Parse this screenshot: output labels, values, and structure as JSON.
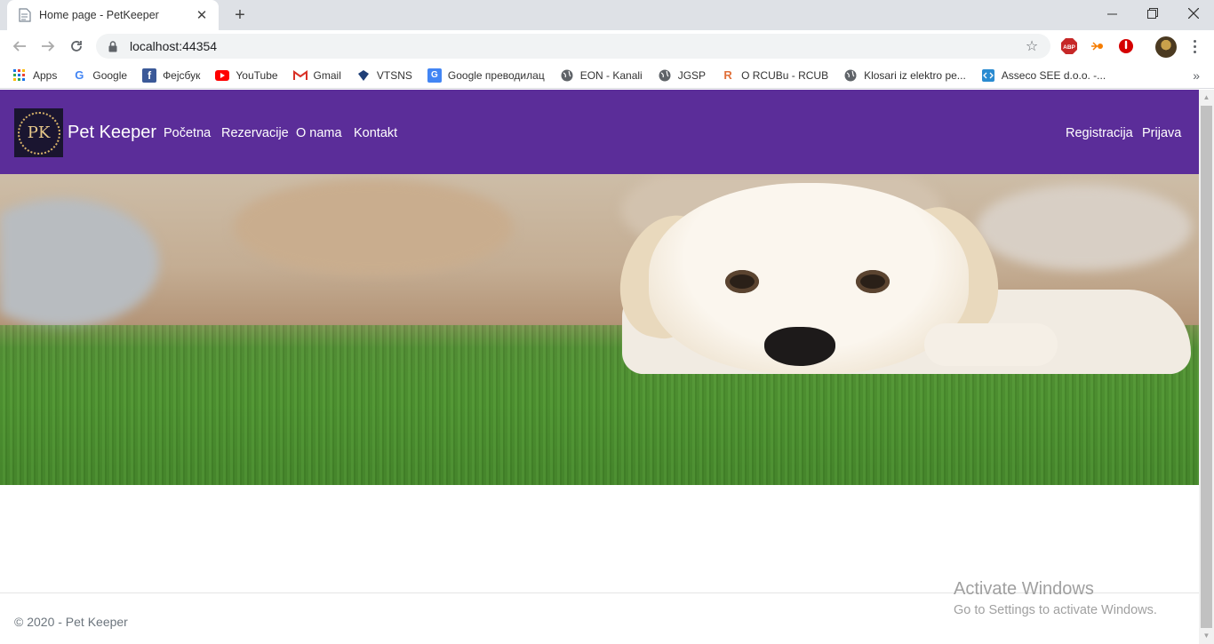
{
  "browser": {
    "tab_title": "Home page - PetKeeper",
    "url": "localhost:44354",
    "bookmarks": [
      {
        "label": "Apps",
        "icon": "apps-grid-icon",
        "color": "#1a73e8"
      },
      {
        "label": "Google",
        "icon": "google-icon",
        "color": "#4285f4"
      },
      {
        "label": "Фејсбук",
        "icon": "facebook-icon",
        "color": "#3b5998"
      },
      {
        "label": "YouTube",
        "icon": "youtube-icon",
        "color": "#ff0000"
      },
      {
        "label": "Gmail",
        "icon": "gmail-icon",
        "color": "#d93025"
      },
      {
        "label": "VTSNS",
        "icon": "vtsns-icon",
        "color": "#1f3f77"
      },
      {
        "label": "Google преводилац",
        "icon": "google-translate-icon",
        "color": "#4285f4"
      },
      {
        "label": "EON - Kanali",
        "icon": "globe-icon",
        "color": "#5f6368"
      },
      {
        "label": "JGSP",
        "icon": "globe-icon",
        "color": "#5f6368"
      },
      {
        "label": "O RCUBu - RCUB",
        "icon": "rcub-icon",
        "color": "#e0703a"
      },
      {
        "label": "Klosari iz elektro pe...",
        "icon": "globe-icon",
        "color": "#5f6368"
      },
      {
        "label": "Asseco SEE d.o.o. -...",
        "icon": "asseco-icon",
        "color": "#2a8bd1"
      }
    ]
  },
  "site": {
    "brand": "Pet Keeper",
    "logo_text": "PK",
    "nav_left": [
      "Početna",
      "Rezervacije",
      "O nama",
      "Kontakt"
    ],
    "nav_right": [
      "Registracija",
      "Prijava"
    ],
    "nav_color": "#5b2d99",
    "footer": "© 2020 - Pet Keeper"
  },
  "os_watermark": {
    "title": "Activate Windows",
    "subtitle": "Go to Settings to activate Windows."
  }
}
